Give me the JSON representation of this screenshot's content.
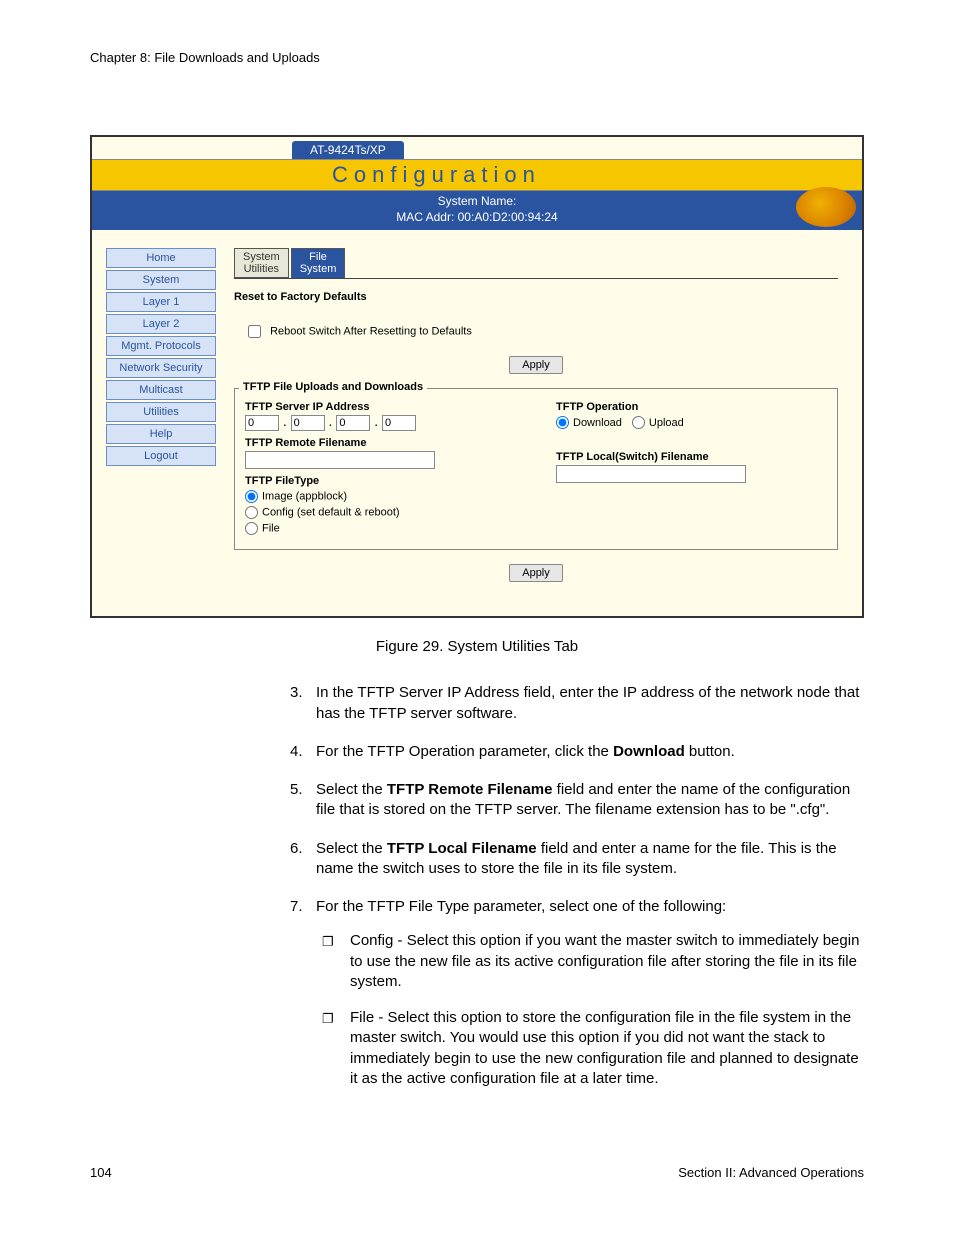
{
  "chapter": "Chapter 8: File Downloads and Uploads",
  "page_number": "104",
  "section_footer": "Section II: Advanced Operations",
  "figure_caption": "Figure 29. System Utilities Tab",
  "screenshot": {
    "model": "AT-9424Ts/XP",
    "banner": "Configuration",
    "system_name_label": "System Name:",
    "mac_label": "MAC Addr: 00:A0:D2:00:94:24",
    "nav": [
      "Home",
      "System",
      "Layer 1",
      "Layer 2",
      "Mgmt. Protocols",
      "Network Security",
      "Multicast",
      "Utilities",
      "Help",
      "Logout"
    ],
    "tabs": {
      "inactive": "System\nUtilities",
      "active": "File\nSystem"
    },
    "reset_heading": "Reset to Factory Defaults",
    "reboot_checkbox_label": "Reboot Switch After Resetting to Defaults",
    "apply_label": "Apply",
    "tftp": {
      "legend": "TFTP File Uploads and Downloads",
      "ip_label": "TFTP Server IP Address",
      "ip": [
        "0",
        "0",
        "0",
        "0"
      ],
      "remote_label": "TFTP Remote Filename",
      "filetype_label": "TFTP FileType",
      "filetype_options": [
        "Image (appblock)",
        "Config (set default & reboot)",
        "File"
      ],
      "filetype_selected": 0,
      "operation_label": "TFTP Operation",
      "operation_options": [
        "Download",
        "Upload"
      ],
      "operation_selected": 0,
      "local_label": "TFTP Local(Switch) Filename"
    }
  },
  "steps": [
    {
      "n": "3.",
      "text": "In the TFTP Server IP Address field, enter the IP address of the network node that has the TFTP server software."
    },
    {
      "n": "4.",
      "text_parts": [
        "For the TFTP Operation parameter, click the ",
        "Download",
        " button."
      ]
    },
    {
      "n": "5.",
      "text_parts": [
        "Select the ",
        "TFTP Remote Filename",
        " field and enter the name of the configuration file that is stored on the TFTP server. The filename extension has to be \".cfg\"."
      ]
    },
    {
      "n": "6.",
      "text_parts": [
        "Select the ",
        "TFTP Local Filename",
        " field and enter a name for the file. This is the name the switch uses to store the file in its file system."
      ]
    },
    {
      "n": "7.",
      "text": "For the TFTP File Type parameter, select one of the following:",
      "subs": [
        "Config - Select this option if you want the master switch to immediately begin to use the new file as its active configuration file after storing the file in its file system.",
        "File - Select this option to store the configuration file in the file system in the master switch. You would use this option if you did not want the stack to immediately begin to use the new configuration file and planned to designate it as the active configuration file at a later time."
      ]
    }
  ]
}
